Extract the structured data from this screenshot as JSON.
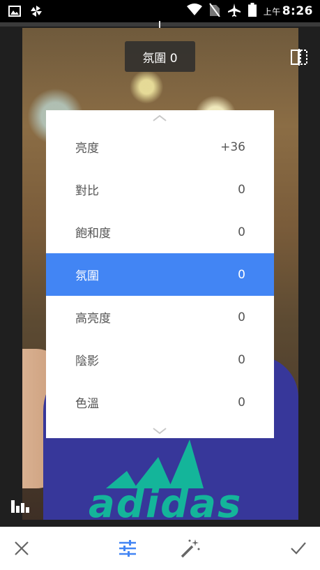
{
  "status_bar": {
    "time_prefix": "上午",
    "time": "8:26",
    "icons": [
      "image-icon",
      "pinwheel-icon",
      "wifi-icon",
      "no-sim-icon",
      "airplane-icon",
      "battery-icon"
    ]
  },
  "value_label": "氛圍 0",
  "adjust_menu": {
    "items": [
      {
        "label": "亮度",
        "value": "+36"
      },
      {
        "label": "對比",
        "value": "0"
      },
      {
        "label": "飽和度",
        "value": "0"
      },
      {
        "label": "氛圍",
        "value": "0",
        "selected": true
      },
      {
        "label": "高亮度",
        "value": "0"
      },
      {
        "label": "陰影",
        "value": "0"
      },
      {
        "label": "色溫",
        "value": "0"
      }
    ]
  },
  "photo": {
    "shirt_text": "adidas"
  },
  "toolbar": {
    "icons": [
      "close-icon",
      "tune-icon",
      "auto-enhance-wand-icon",
      "check-icon"
    ],
    "accent_color": "#4285f4"
  },
  "colors": {
    "selected_row": "#4285f4",
    "menu_bg": "#ffffff"
  }
}
